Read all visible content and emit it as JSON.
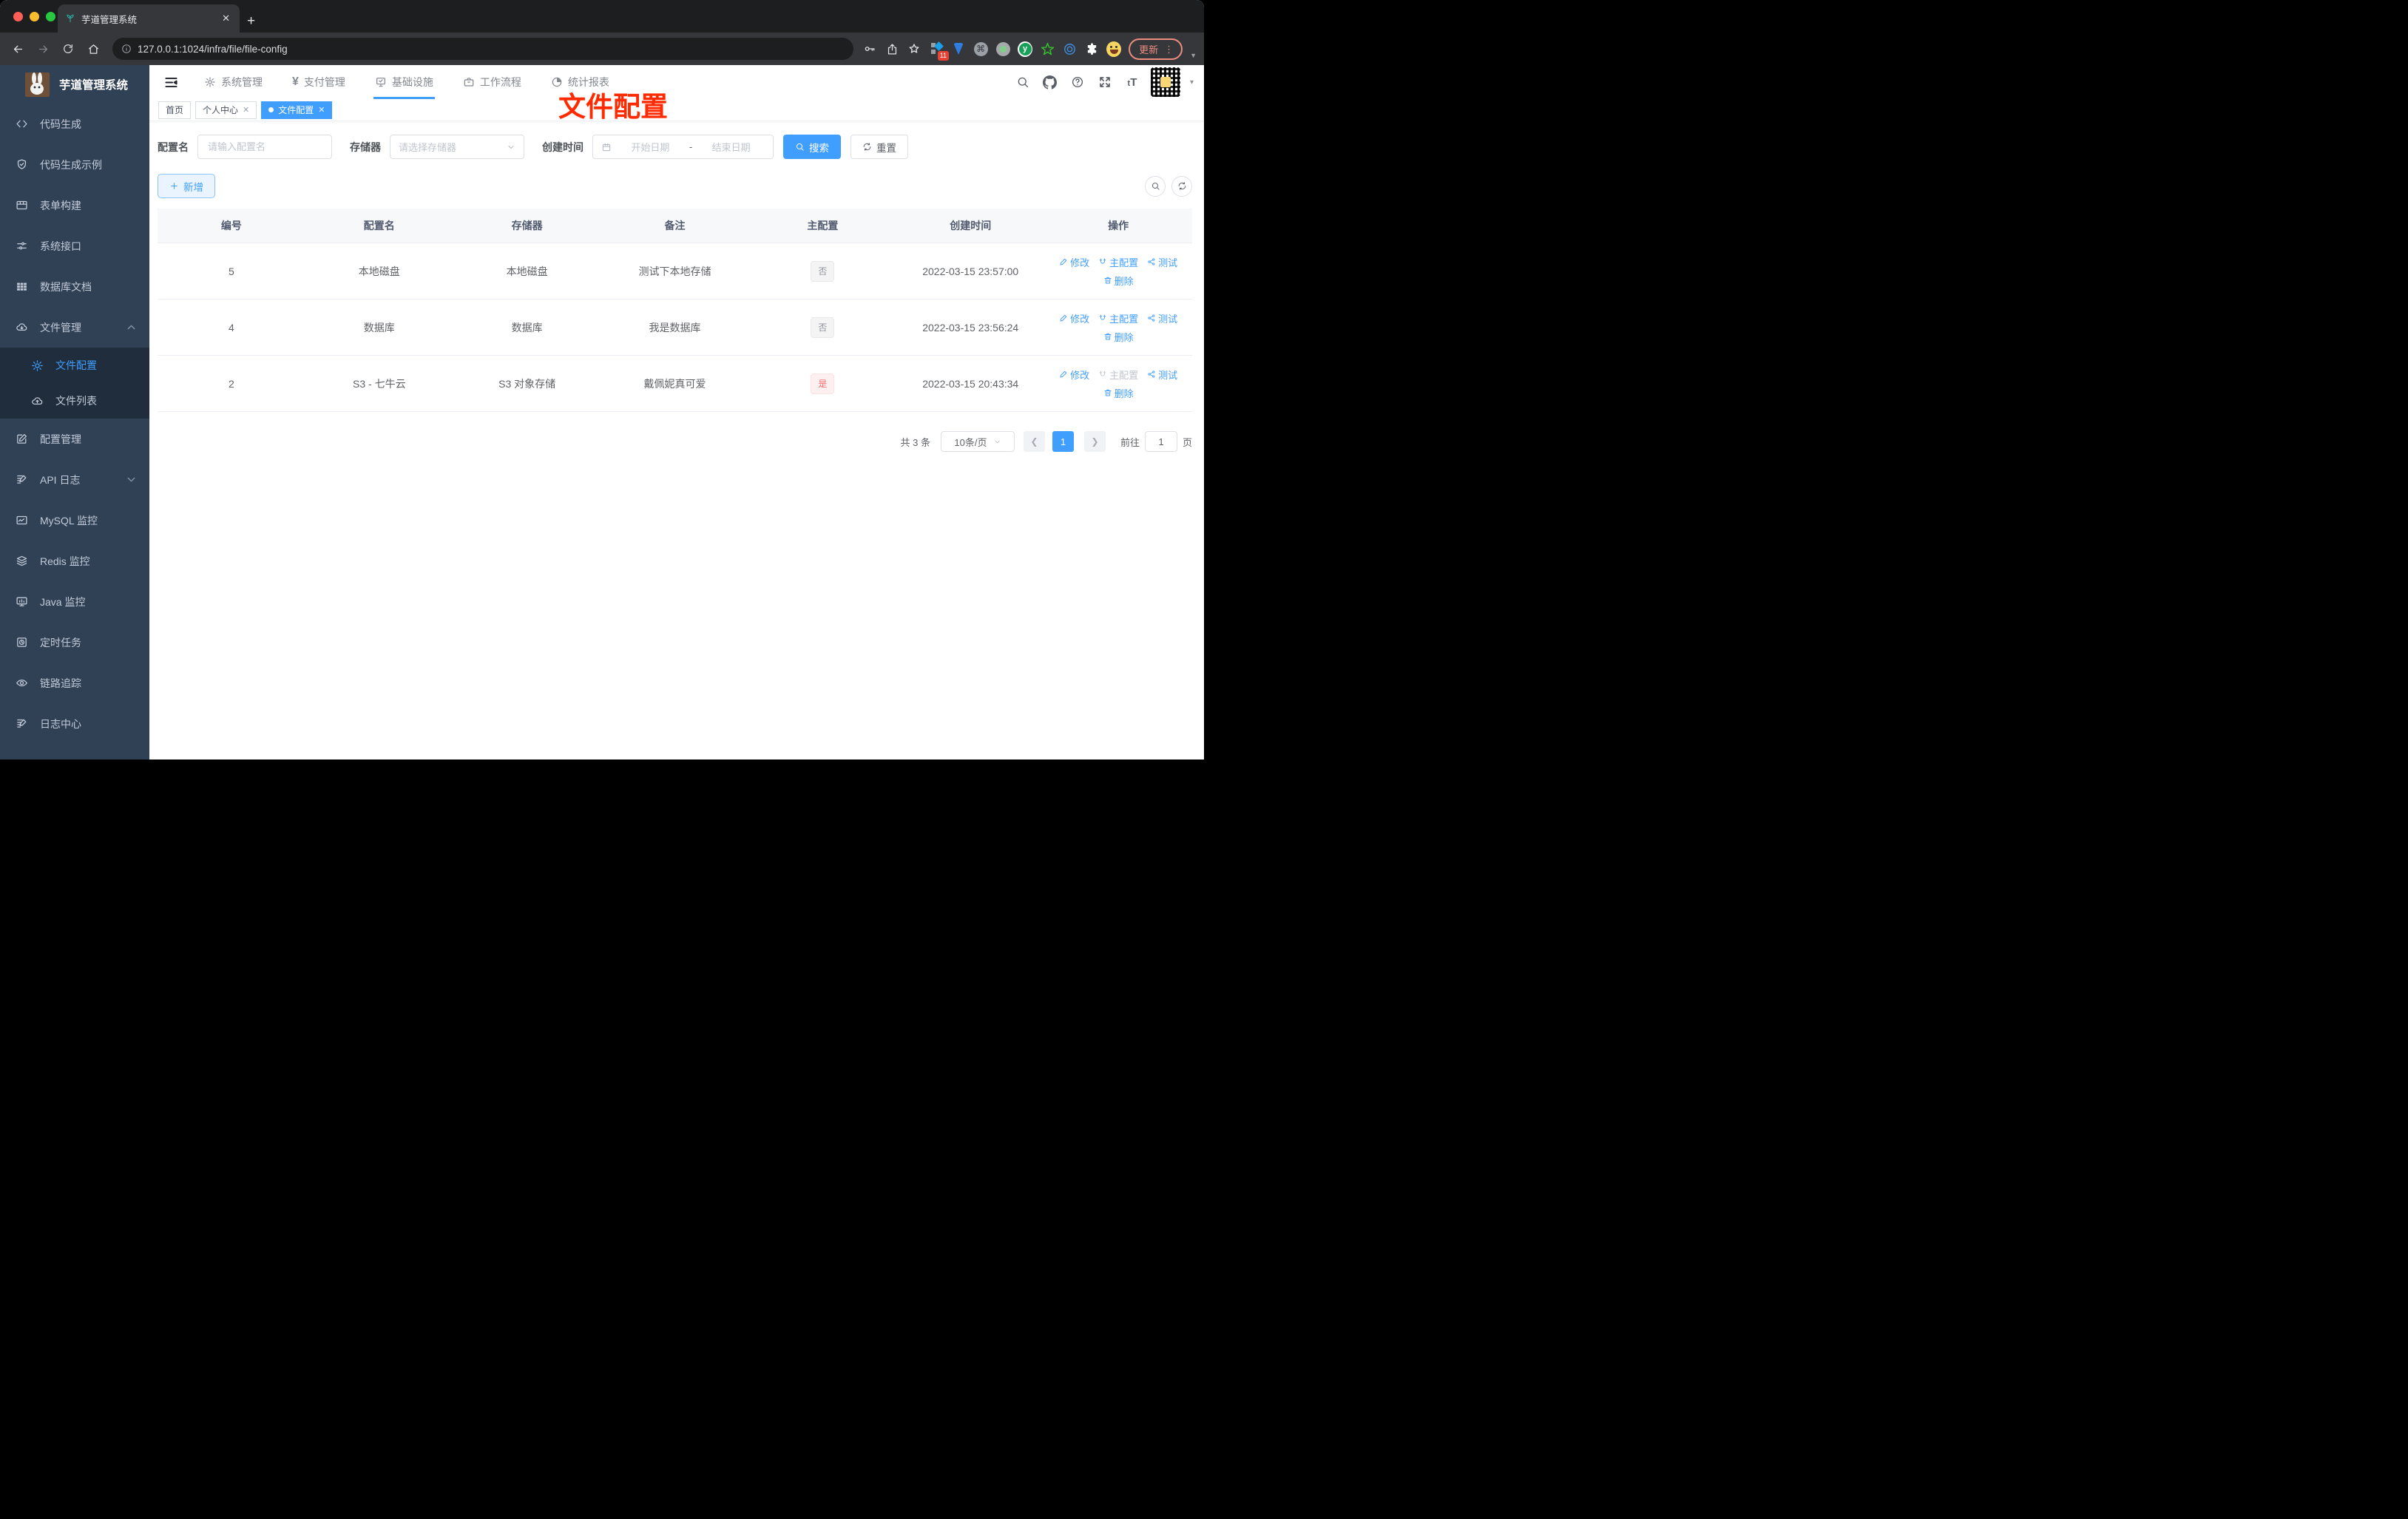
{
  "browser": {
    "tab_title": "芋道管理系统",
    "url": "127.0.0.1:1024/infra/file/file-config",
    "update_label": "更新",
    "extension_badge": "11"
  },
  "sidebar": {
    "logo_title": "芋道管理系统",
    "items": [
      {
        "label": "代码生成"
      },
      {
        "label": "代码生成示例"
      },
      {
        "label": "表单构建"
      },
      {
        "label": "系统接口"
      },
      {
        "label": "数据库文档"
      },
      {
        "label": "文件管理"
      },
      {
        "label": "文件配置"
      },
      {
        "label": "文件列表"
      },
      {
        "label": "配置管理"
      },
      {
        "label": "API 日志"
      },
      {
        "label": "MySQL 监控"
      },
      {
        "label": "Redis 监控"
      },
      {
        "label": "Java 监控"
      },
      {
        "label": "定时任务"
      },
      {
        "label": "链路追踪"
      },
      {
        "label": "日志中心"
      }
    ]
  },
  "topnav": {
    "items": [
      {
        "label": "系统管理"
      },
      {
        "label": "支付管理"
      },
      {
        "label": "基础设施"
      },
      {
        "label": "工作流程"
      },
      {
        "label": "统计报表"
      }
    ]
  },
  "tabs": {
    "home": "首页",
    "profile": "个人中心",
    "fileconfig": "文件配置"
  },
  "annotation": {
    "text": "文件配置",
    "color": "#ff2a00"
  },
  "filters": {
    "name_label": "配置名",
    "name_placeholder": "请输入配置名",
    "storage_label": "存储器",
    "storage_placeholder": "请选择存储器",
    "time_label": "创建时间",
    "start_placeholder": "开始日期",
    "range_separator": "-",
    "end_placeholder": "结束日期",
    "search_label": "搜索",
    "reset_label": "重置"
  },
  "toolbar": {
    "add_label": "新增"
  },
  "table": {
    "columns": [
      "编号",
      "配置名",
      "存储器",
      "备注",
      "主配置",
      "创建时间",
      "操作"
    ],
    "rows": [
      {
        "id": "5",
        "name": "本地磁盘",
        "storage": "本地磁盘",
        "remark": "测试下本地存储",
        "master": "否",
        "created": "2022-03-15 23:57:00"
      },
      {
        "id": "4",
        "name": "数据库",
        "storage": "数据库",
        "remark": "我是数据库",
        "master": "否",
        "created": "2022-03-15 23:56:24"
      },
      {
        "id": "2",
        "name": "S3 - 七牛云",
        "storage": "S3 对象存储",
        "remark": "戴佩妮真可爱",
        "master": "是",
        "created": "2022-03-15 20:43:34"
      }
    ],
    "actions": {
      "edit": "修改",
      "master": "主配置",
      "test": "测试",
      "delete": "删除"
    }
  },
  "pagination": {
    "total": "共 3 条",
    "page_size": "10条/页",
    "current_page": "1",
    "goto_label": "前往",
    "goto_value": "1",
    "page_unit": "页"
  },
  "colors": {
    "accent": "#409eff",
    "sidebar_bg": "#304156",
    "submenu_bg": "#1f2d3d",
    "tag_info_text": "#909399",
    "tag_danger_text": "#f56c6c"
  }
}
